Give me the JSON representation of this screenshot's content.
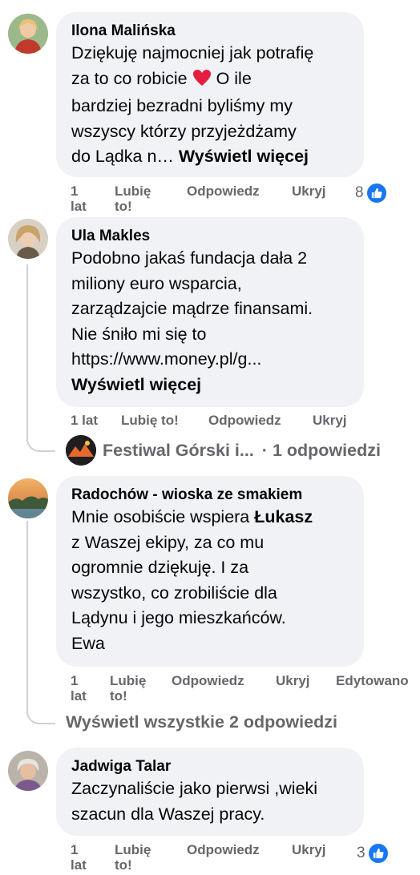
{
  "comments": [
    {
      "author": "Ilona Malińska",
      "lines": [
        "Dziękuję najmocniej jak potrafię",
        "za to co robicie",
        "bardziej bezradni byliśmy my",
        "wszyscy którzy przyjeżdżamy",
        "do Lądka n…"
      ],
      "line2_tail": "O ile",
      "see_more": "Wyświetl więcej",
      "time": [
        "1",
        "lat"
      ],
      "like": [
        "Lubię",
        "to!"
      ],
      "reply": "Odpowiedz",
      "hide": "Ukryj",
      "reactions": "8"
    },
    {
      "author": "Ula Makles",
      "lines": [
        "Podobno jakaś fundacja dała 2",
        "miliony euro wsparcia,",
        "zarządzajcie mądrze finansami.",
        "Nie śniło mi się to",
        "https://www.money.pl/g..."
      ],
      "see_more": "Wyświetl więcej",
      "time": "1 lat",
      "like": "Lubię to!",
      "reply": "Odpowiedz",
      "hide": "Ukryj",
      "reply_preview": {
        "name": "Festiwal Górski i...",
        "separator": "·",
        "count": "1 odpowiedzi"
      }
    },
    {
      "author": "Radochów - wioska ze smakiem",
      "line1_prefix": "Mnie osobiście wspiera",
      "line1_bold": "Łukasz",
      "lines": [
        "z Waszej ekipy, za co mu",
        "ogromnie dziękuję. I za",
        "wszystko, co zrobiliście dla",
        "Lądynu i jego mieszkańców.",
        "Ewa"
      ],
      "time": [
        "1",
        "lat"
      ],
      "like": [
        "Lubię",
        "to!"
      ],
      "reply": "Odpowiedz",
      "hide": "Ukryj",
      "edited": "Edytowano",
      "view_all": "Wyświetl wszystkie 2 odpowiedzi"
    },
    {
      "author": "Jadwiga Talar",
      "lines": [
        "Zaczynaliście jako pierwsi ,wieki",
        "szacun dla Waszej pracy."
      ],
      "time": [
        "1",
        "lat"
      ],
      "like": [
        "Lubię",
        "to!"
      ],
      "reply": "Odpowiedz",
      "hide": "Ukryj",
      "reactions": "3"
    }
  ],
  "icons": {
    "heart": "red-heart-emoji",
    "like": "thumbs-up-icon"
  },
  "colors": {
    "bubble": "#f0f2f5",
    "secondary_text": "#65676b",
    "like_blue": "#1877f2",
    "heart_red": "#e41e3f"
  }
}
